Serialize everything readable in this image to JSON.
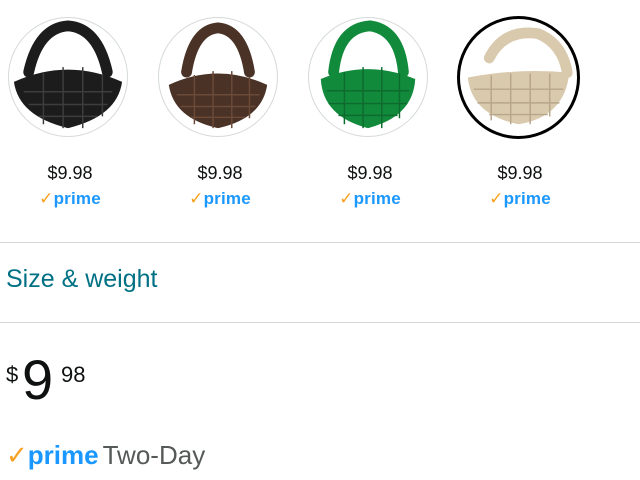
{
  "swatches": [
    {
      "color_name": "Black",
      "color": "#1c1c1c",
      "price": "$9.98",
      "prime": "prime",
      "selected": false
    },
    {
      "color_name": "Brown",
      "color": "#4a3226",
      "price": "$9.98",
      "prime": "prime",
      "selected": false
    },
    {
      "color_name": "Green",
      "color": "#128a3c",
      "price": "$9.98",
      "prime": "prime",
      "selected": false
    },
    {
      "color_name": "Beige",
      "color": "#d9c9ad",
      "price": "$9.98",
      "prime": "prime",
      "selected": true
    }
  ],
  "size_weight_link": "Size & weight",
  "price": {
    "symbol": "$",
    "whole": "9",
    "fraction": "98"
  },
  "delivery": {
    "check": "✓",
    "prime": "prime",
    "label": "Two-Day"
  },
  "colors": {
    "prime_blue": "#1a98ff",
    "prime_check": "#f7a11f",
    "link": "#007185",
    "divider": "#d5d9d9"
  }
}
